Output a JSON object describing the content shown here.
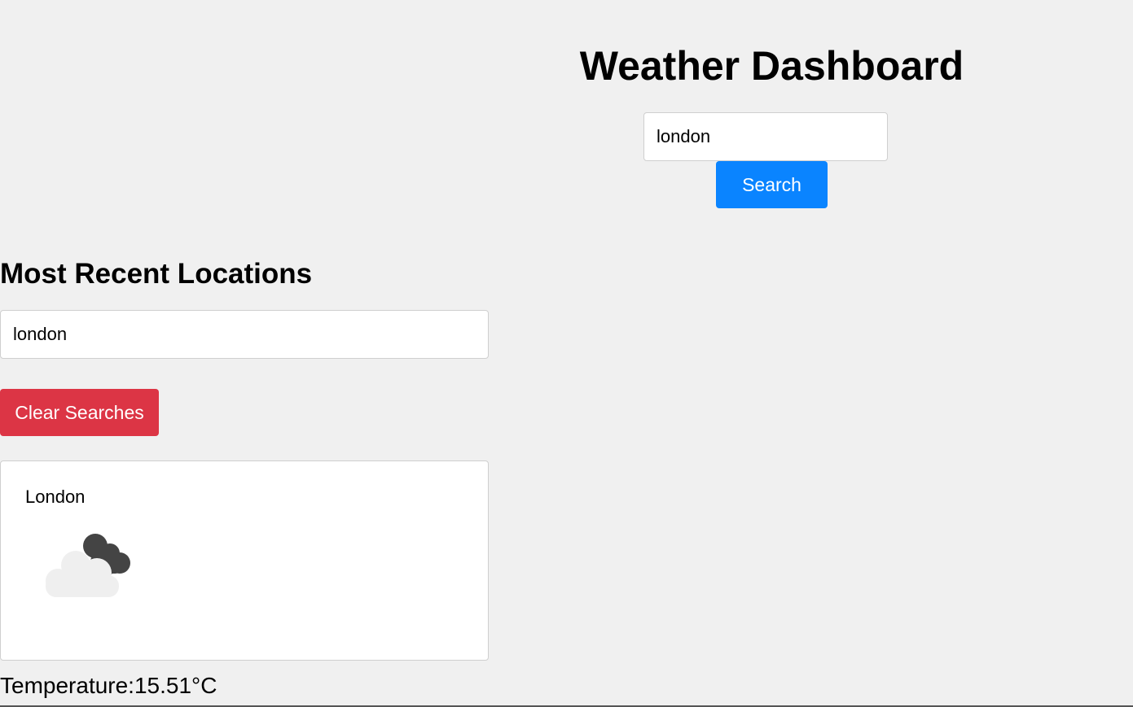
{
  "header": {
    "title": "Weather Dashboard"
  },
  "search": {
    "value": "london",
    "button_label": "Search"
  },
  "recent": {
    "heading": "Most Recent Locations",
    "items": [
      {
        "label": "london"
      }
    ],
    "clear_label": "Clear Searches"
  },
  "weather": {
    "city": "London",
    "icon": "broken-clouds-icon",
    "temperature_text": "Temperature:15.51°C"
  },
  "colors": {
    "background": "#f0f0f0",
    "search_button": "#0a84ff",
    "clear_button": "#dc3545",
    "card_border": "#cfcfcf",
    "cloud_light": "#efefef",
    "cloud_dark": "#444444"
  }
}
